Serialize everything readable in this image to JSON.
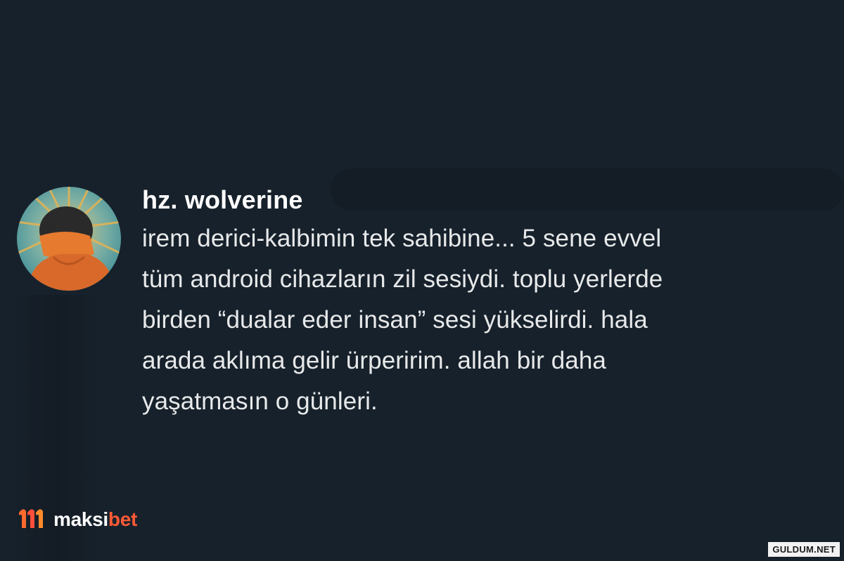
{
  "post": {
    "username": "hz. wolverine",
    "text": "irem derici-kalbimin tek sahibine... 5 sene evvel\ntüm android cihazların zil sesiydi. toplu yerlerde\nbirden “dualar eder insan” sesi yükselirdi. hala\narada aklıma gelir ürperirim. allah bir daha\nyaşatmasın o günleri."
  },
  "brand": {
    "name_part1": "maksi",
    "name_part2": "bet",
    "logo_icon": "maksibet-logo-icon"
  },
  "watermark": {
    "text": "GULDUM.NET"
  },
  "colors": {
    "background": "#17212b",
    "text": "#e7e9ea",
    "username": "#ffffff",
    "brand_accent": "#ff5a36"
  }
}
